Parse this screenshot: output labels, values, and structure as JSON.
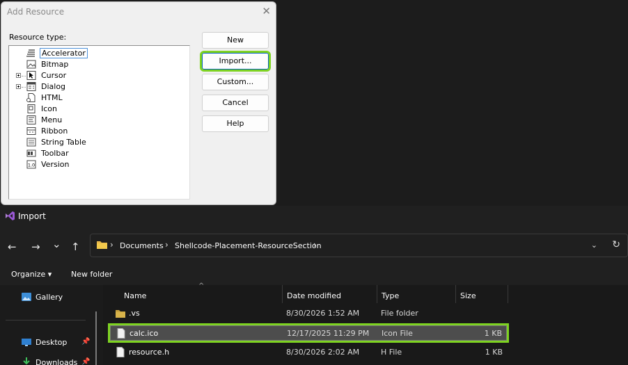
{
  "dialog": {
    "title": "Add Resource",
    "close_glyph": "✕",
    "resource_type_label": "Resource type:",
    "tree": [
      {
        "label": "Accelerator",
        "icon": "accelerator-icon",
        "expandable": false,
        "selected": true
      },
      {
        "label": "Bitmap",
        "icon": "bitmap-icon",
        "expandable": false,
        "selected": false
      },
      {
        "label": "Cursor",
        "icon": "cursor-icon",
        "expandable": true,
        "selected": false
      },
      {
        "label": "Dialog",
        "icon": "dialog-icon",
        "expandable": true,
        "selected": false
      },
      {
        "label": "HTML",
        "icon": "html-icon",
        "expandable": false,
        "selected": false
      },
      {
        "label": "Icon",
        "icon": "icon-resource-icon",
        "expandable": false,
        "selected": false
      },
      {
        "label": "Menu",
        "icon": "menu-icon",
        "expandable": false,
        "selected": false
      },
      {
        "label": "Ribbon",
        "icon": "ribbon-icon",
        "expandable": false,
        "selected": false
      },
      {
        "label": "String Table",
        "icon": "string-table-icon",
        "expandable": false,
        "selected": false
      },
      {
        "label": "Toolbar",
        "icon": "toolbar-icon",
        "expandable": false,
        "selected": false
      },
      {
        "label": "Version",
        "icon": "version-icon",
        "expandable": false,
        "selected": false
      }
    ],
    "buttons": {
      "new": "New",
      "import": "Import...",
      "custom": "Custom...",
      "cancel": "Cancel",
      "help": "Help"
    }
  },
  "import_window": {
    "title": "Import",
    "nav": {
      "back": "←",
      "forward": "→",
      "recent": "⌄",
      "up": "↑"
    },
    "breadcrumb": [
      "Documents",
      "Shellcode-Placement-ResourceSection"
    ],
    "breadcrumb_sep": "›",
    "address_dropdown": "⌄",
    "refresh": "↻",
    "toolbar": {
      "organize": "Organize ▾",
      "new_folder": "New folder"
    },
    "sidebar": [
      {
        "label": "Gallery",
        "icon": "gallery-icon"
      },
      {
        "label": "Desktop",
        "icon": "desktop-icon",
        "pinned": true
      },
      {
        "label": "Downloads",
        "icon": "downloads-icon",
        "pinned": true
      }
    ],
    "columns": {
      "name": "Name",
      "date": "Date modified",
      "type": "Type",
      "size": "Size"
    },
    "files": [
      {
        "name": ".vs",
        "date": "8/30/2026 1:52 AM",
        "type": "File folder",
        "size": "",
        "icon": "folder-icon",
        "selected": false
      },
      {
        "name": "calc.ico",
        "date": "12/17/2025 11:29 PM",
        "type": "Icon File",
        "size": "1 KB",
        "icon": "file-icon",
        "selected": true
      },
      {
        "name": "resource.h",
        "date": "8/30/2026 2:02 AM",
        "type": "H File",
        "size": "1 KB",
        "icon": "file-icon",
        "selected": false
      }
    ]
  },
  "colors": {
    "highlight": "#7ed321",
    "folder": "#d8b34a",
    "dark_bg": "#202020"
  }
}
